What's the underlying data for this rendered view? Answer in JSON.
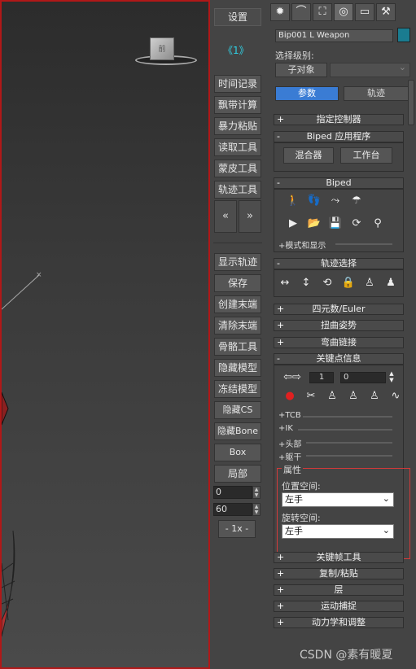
{
  "viewport": {
    "cube_label": "前"
  },
  "midbar": {
    "settings": "设置",
    "link": "《1》",
    "buttons": [
      "时间记录",
      "飘带计算",
      "暴力粘贴",
      "读取工具",
      "蒙皮工具",
      "轨迹工具"
    ],
    "nav_left": "«",
    "nav_right": "»",
    "buttons2": [
      "显示轨迹",
      "保存",
      "创建末端",
      "清除末端",
      "骨骼工具",
      "隐藏模型",
      "冻结模型",
      "隐藏CS",
      "隐藏Bone",
      "Box",
      "局部"
    ],
    "spinner_a": "0",
    "spinner_b": "60",
    "speed": "- 1x -"
  },
  "panel": {
    "tabs": [
      "✹",
      "⌒",
      "⛶",
      "◎",
      "▭",
      "⚒"
    ],
    "object_name": "Bip001 L Weapon",
    "swatch_color": "#1a7c90",
    "level_label": "选择级别:",
    "sub_object": "子对象",
    "mode_params": "参数",
    "mode_track": "轨迹",
    "rollouts": {
      "assign_controller": "指定控制器",
      "biped_app": "Biped 应用程序",
      "mixer": "混合器",
      "workbench": "工作台",
      "biped": "Biped",
      "modes_display": "+模式和显示",
      "track_select": "轨迹选择",
      "quaternion": "四元数/Euler",
      "twist": "扭曲姿势",
      "bend": "弯曲链接",
      "key_info": "关键点信息",
      "key_num": "1",
      "key_time": "0",
      "tcb": "+TCB",
      "ik": "+IK",
      "head": "+头部",
      "body": "+躯干",
      "props": "属性",
      "pos_space": "位置空间:",
      "pos_value": "左手",
      "rot_space": "旋转空间:",
      "rot_value": "左手",
      "key_tools": "关键帧工具",
      "copy_paste": "复制/粘贴",
      "layers": "层",
      "motion_capture": "运动捕捉",
      "dynamics": "动力学和调整"
    }
  },
  "watermark": "CSDN @素有暖夏"
}
